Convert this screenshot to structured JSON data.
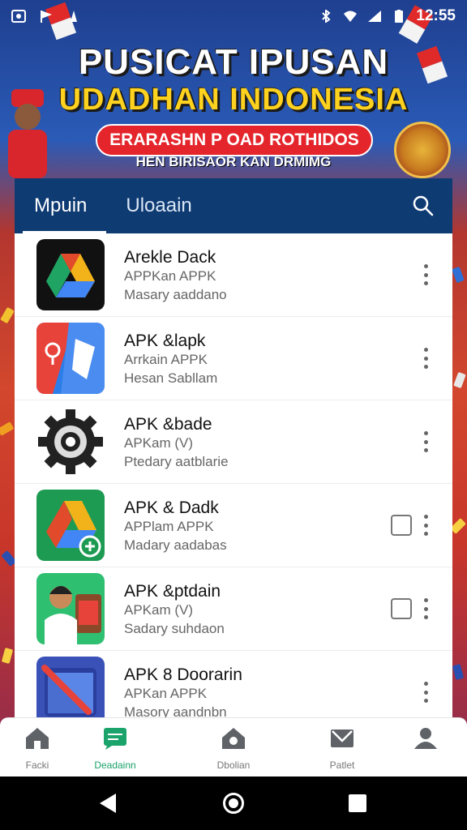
{
  "status_bar": {
    "time": "12:55",
    "left_icons": [
      "screenshot-icon",
      "flag-notification-icon",
      "app-notification-icon"
    ],
    "right_icons": [
      "bluetooth-icon",
      "wifi-icon",
      "cell-signal-icon",
      "battery-icon"
    ]
  },
  "banner": {
    "line1": "PUSICAT IPUSAN",
    "line2": "UDADHAN INDONESIA",
    "pill": "ERARASHN P OAD ROTHIDOS",
    "subtitle": "HEN BIRISAOR KAN DRMIMG"
  },
  "tabs": [
    {
      "label": "Mpuin",
      "active": true
    },
    {
      "label": "Uloaain",
      "active": false
    }
  ],
  "apps": [
    {
      "title": "Arekle Dack",
      "subtitle": "APPKan APPK",
      "desc": "Masary aaddano",
      "icon": "drive-triangle-dark-icon",
      "install_button": false
    },
    {
      "title": "APK &lapk",
      "subtitle": "Arrkain APPK",
      "desc": "Hesan Sabllam",
      "icon": "maps-icon",
      "install_button": false
    },
    {
      "title": "APK &bade",
      "subtitle": "APKam (V)",
      "desc": "Ptedary aatblarie",
      "icon": "gear-icon",
      "install_button": false
    },
    {
      "title": "APK & Dadk",
      "subtitle": "APPlam APPK",
      "desc": "Madary aadabas",
      "icon": "drive-triangle-green-icon",
      "install_button": true
    },
    {
      "title": "APK &ptdain",
      "subtitle": "APKam (V)",
      "desc": "Sadary suhdaon",
      "icon": "person-illustration-icon",
      "install_button": true
    },
    {
      "title": "APK 8 Doorarin",
      "subtitle": "APKan APPK",
      "desc": "Masory aandnbn",
      "icon": "envelope-icon",
      "install_button": false
    }
  ],
  "bottom_nav": [
    {
      "label": "Facki",
      "icon": "home-icon",
      "active": false
    },
    {
      "label": "Deadainn",
      "icon": "chat-icon",
      "active": true
    },
    {
      "label": "Dbolian",
      "icon": "house-badge-icon",
      "active": false
    },
    {
      "label": "Patlet",
      "icon": "mail-icon",
      "active": false
    },
    {
      "label": "",
      "icon": "profile-icon",
      "active": false
    }
  ],
  "colors": {
    "tabbar": "#0f3b73",
    "accent_active": "#1aa36a",
    "banner_yellow": "#ffd21f",
    "banner_red": "#e4252c"
  }
}
